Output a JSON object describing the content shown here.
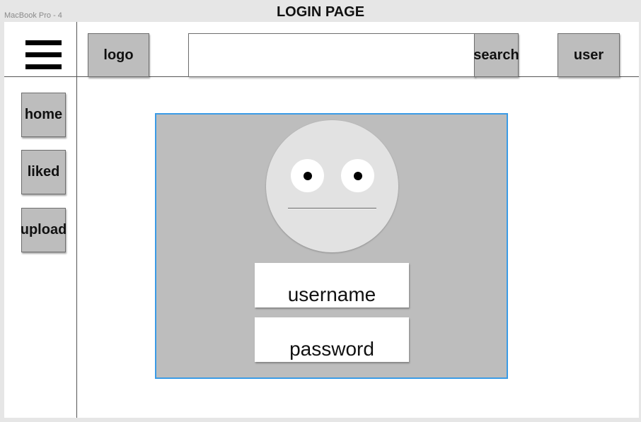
{
  "artboard": {
    "label": "MacBook Pro - 4"
  },
  "page": {
    "title": "LOGIN PAGE"
  },
  "header": {
    "menu_icon": "hamburger-menu-icon",
    "logo_label": "logo",
    "search": {
      "value": "",
      "placeholder": "",
      "button_label": "search"
    },
    "user_label": "user"
  },
  "sidebar": {
    "items": [
      {
        "label": "home"
      },
      {
        "label": "liked"
      },
      {
        "label": "upload"
      }
    ]
  },
  "login": {
    "avatar_icon": "neutral-face-avatar-icon",
    "username_placeholder": "username",
    "password_placeholder": "password"
  },
  "colors": {
    "panel_border": "#3a9be6",
    "button_fill": "#bdbdbd",
    "panel_fill": "#bdbdbd"
  }
}
